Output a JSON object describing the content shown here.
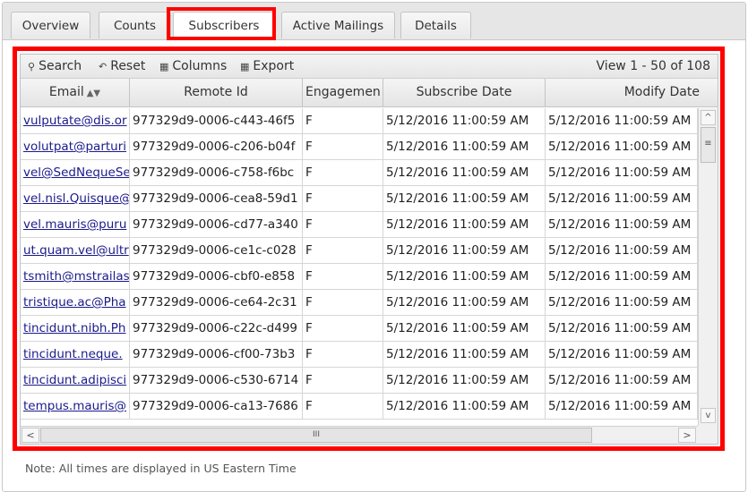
{
  "tabs": [
    {
      "label": "Overview"
    },
    {
      "label": "Counts"
    },
    {
      "label": "Subscribers",
      "active": true
    },
    {
      "label": "Active Mailings"
    },
    {
      "label": "Details"
    }
  ],
  "toolbar": {
    "search": "Search",
    "reset": "Reset",
    "columns": "Columns",
    "export": "Export",
    "view_info": "View 1 - 50 of 108"
  },
  "columns": [
    "Email",
    "Remote Id",
    "Engagemen",
    "Subscribe Date",
    "Modify Date"
  ],
  "rows": [
    {
      "email": "vulputate@dis.or",
      "remote_id": "977329d9-0006-c443-46f5",
      "engagement": "F",
      "subscribe_date": "5/12/2016 11:00:59 AM",
      "modify_date": "5/12/2016 11:00:59 AM"
    },
    {
      "email": "volutpat@parturi",
      "remote_id": "977329d9-0006-c206-b04f",
      "engagement": "F",
      "subscribe_date": "5/12/2016 11:00:59 AM",
      "modify_date": "5/12/2016 11:00:59 AM"
    },
    {
      "email": "vel@SedNequeSe",
      "remote_id": "977329d9-0006-c758-f6bc",
      "engagement": "F",
      "subscribe_date": "5/12/2016 11:00:59 AM",
      "modify_date": "5/12/2016 11:00:59 AM"
    },
    {
      "email": "vel.nisl.Quisque@",
      "remote_id": "977329d9-0006-cea8-59d1",
      "engagement": "F",
      "subscribe_date": "5/12/2016 11:00:59 AM",
      "modify_date": "5/12/2016 11:00:59 AM"
    },
    {
      "email": "vel.mauris@puru",
      "remote_id": "977329d9-0006-cd77-a340",
      "engagement": "F",
      "subscribe_date": "5/12/2016 11:00:59 AM",
      "modify_date": "5/12/2016 11:00:59 AM"
    },
    {
      "email": "ut.quam.vel@ultr",
      "remote_id": "977329d9-0006-ce1c-c028",
      "engagement": "F",
      "subscribe_date": "5/12/2016 11:00:59 AM",
      "modify_date": "5/12/2016 11:00:59 AM"
    },
    {
      "email": "tsmith@mstrailas",
      "remote_id": "977329d9-0006-cbf0-e858",
      "engagement": "F",
      "subscribe_date": "5/12/2016 11:00:59 AM",
      "modify_date": "5/12/2016 11:00:59 AM"
    },
    {
      "email": "tristique.ac@Pha",
      "remote_id": "977329d9-0006-ce64-2c31",
      "engagement": "F",
      "subscribe_date": "5/12/2016 11:00:59 AM",
      "modify_date": "5/12/2016 11:00:59 AM"
    },
    {
      "email": "tincidunt.nibh.Ph",
      "remote_id": "977329d9-0006-c22c-d499",
      "engagement": "F",
      "subscribe_date": "5/12/2016 11:00:59 AM",
      "modify_date": "5/12/2016 11:00:59 AM"
    },
    {
      "email": "tincidunt.neque.",
      "remote_id": "977329d9-0006-cf00-73b3",
      "engagement": "F",
      "subscribe_date": "5/12/2016 11:00:59 AM",
      "modify_date": "5/12/2016 11:00:59 AM"
    },
    {
      "email": "tincidunt.adipisci",
      "remote_id": "977329d9-0006-c530-6714",
      "engagement": "F",
      "subscribe_date": "5/12/2016 11:00:59 AM",
      "modify_date": "5/12/2016 11:00:59 AM"
    },
    {
      "email": "tempus.mauris@",
      "remote_id": "977329d9-0006-ca13-7686",
      "engagement": "F",
      "subscribe_date": "5/12/2016 11:00:59 AM",
      "modify_date": "5/12/2016 11:00:59 AM"
    }
  ],
  "scrollbar": {
    "up": "^",
    "down": "v",
    "left": "<",
    "right": ">",
    "v_grip": "≡",
    "h_grip": "III"
  },
  "note": "Note: All times are displayed in US Eastern Time"
}
